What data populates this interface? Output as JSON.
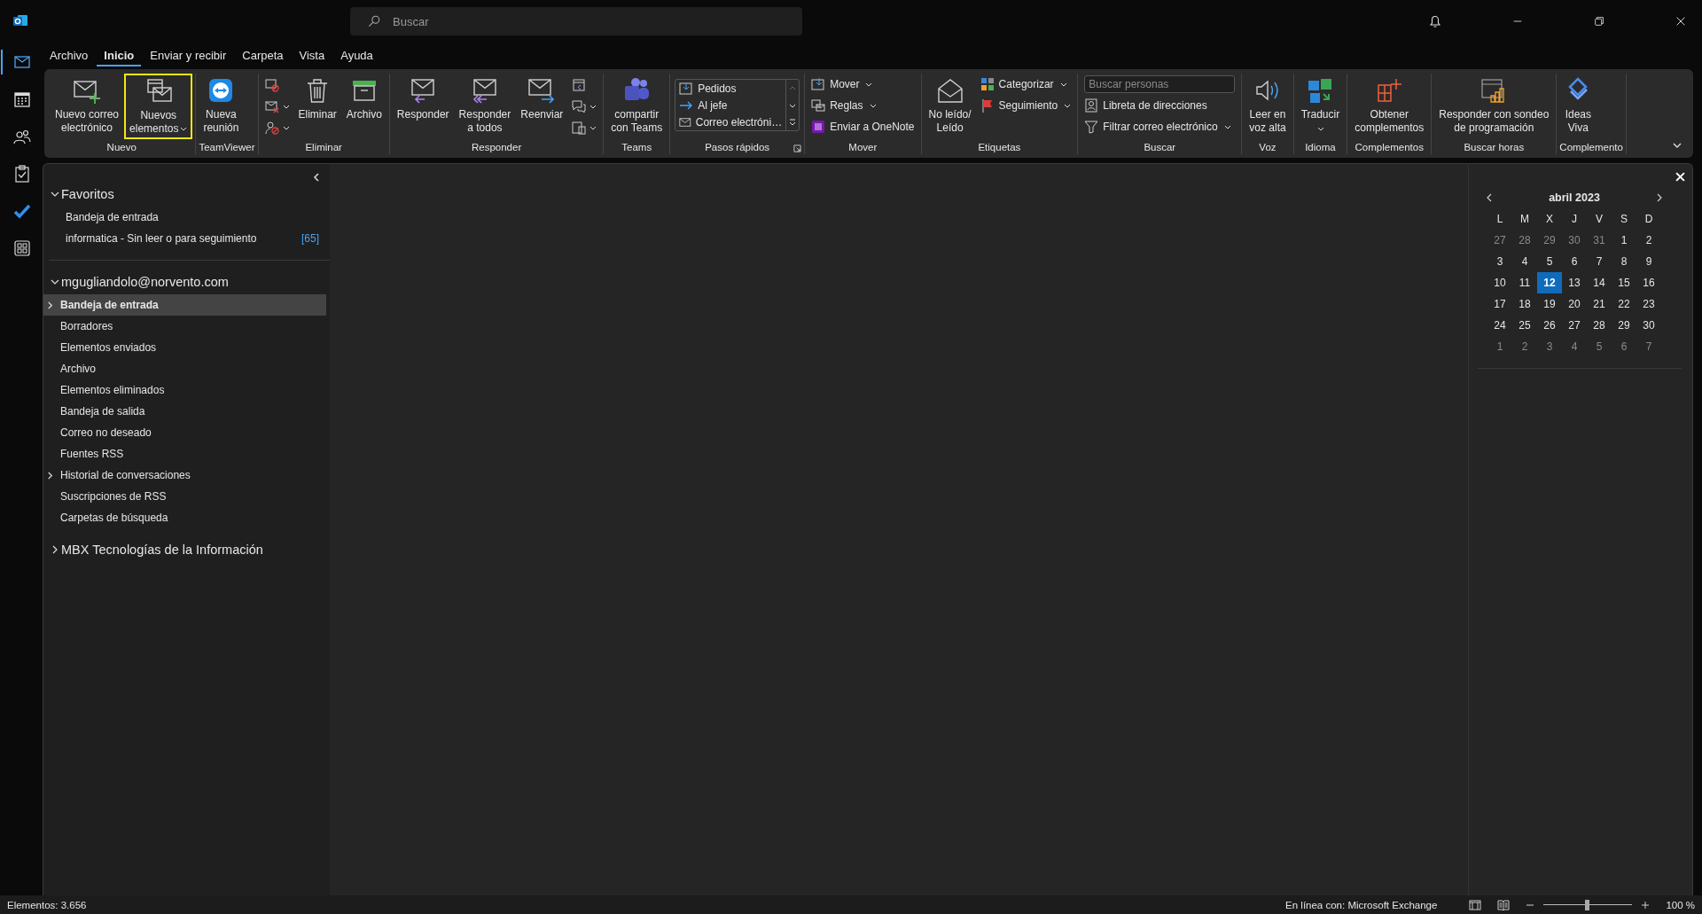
{
  "title_bar": {
    "search_placeholder": "Buscar"
  },
  "nav_rail": [
    {
      "selected": true
    },
    {
      "selected": false
    },
    {
      "selected": false
    },
    {
      "selected": false
    },
    {
      "selected": false
    },
    {
      "selected": false
    }
  ],
  "menu_tabs": [
    {
      "label": "Archivo",
      "selected": false
    },
    {
      "label": "Inicio",
      "selected": true
    },
    {
      "label": "Enviar y recibir",
      "selected": false
    },
    {
      "label": "Carpeta",
      "selected": false
    },
    {
      "label": "Vista",
      "selected": false
    },
    {
      "label": "Ayuda",
      "selected": false
    }
  ],
  "ribbon": {
    "groups": [
      {
        "label": "Nuevo",
        "controls": [
          {
            "kind": "large",
            "label": "Nuevo correo\nelectrónico"
          },
          {
            "kind": "large",
            "label": "Nuevos\nelementos",
            "dropdown": true,
            "highlighted": true
          }
        ]
      },
      {
        "label": "TeamViewer",
        "controls": [
          {
            "kind": "large",
            "label": "Nueva\nreunión"
          }
        ]
      },
      {
        "label": "Eliminar",
        "controls": [
          {
            "kind": "icon_stack",
            "items": [
              {
                "dropdown": false
              },
              {
                "dropdown": true
              },
              {
                "dropdown": true
              }
            ]
          },
          {
            "kind": "large",
            "label": "Eliminar"
          },
          {
            "kind": "large",
            "label": "Archivo"
          }
        ]
      },
      {
        "label": "Responder",
        "controls": [
          {
            "kind": "large",
            "label": "Responder"
          },
          {
            "kind": "large",
            "label": "Responder\na todos"
          },
          {
            "kind": "large",
            "label": "Reenviar"
          },
          {
            "kind": "icon_stack",
            "items": [
              {
                "dropdown": false
              },
              {
                "dropdown": true
              },
              {
                "dropdown": true
              }
            ]
          }
        ]
      },
      {
        "label": "Teams",
        "controls": [
          {
            "kind": "large",
            "label": "compartir\ncon Teams"
          }
        ]
      },
      {
        "label": "Pasos rápidos",
        "launcher": true,
        "controls": [
          {
            "kind": "gallery",
            "items": [
              {
                "label": "Pedidos"
              },
              {
                "label": "Al jefe"
              },
              {
                "label": "Correo electróni…"
              }
            ]
          }
        ]
      },
      {
        "label": "Mover",
        "controls": [
          {
            "kind": "small_stack",
            "items": [
              {
                "label": "Mover",
                "dropdown": true
              },
              {
                "label": "Reglas",
                "dropdown": true
              },
              {
                "label": "Enviar a OneNote",
                "dropdown": false
              }
            ]
          }
        ]
      },
      {
        "label": "Etiquetas",
        "controls": [
          {
            "kind": "large",
            "label": "No leído/\nLeído"
          },
          {
            "kind": "small_stack",
            "items": [
              {
                "label": "Categorizar",
                "dropdown": true
              },
              {
                "label": "Seguimiento",
                "dropdown": true
              }
            ]
          }
        ]
      },
      {
        "label": "Buscar",
        "controls": [
          {
            "kind": "search_stack",
            "placeholder": "Buscar personas",
            "items": [
              {
                "label": "Libreta de direcciones",
                "dropdown": false
              },
              {
                "label": "Filtrar correo electrónico",
                "dropdown": true
              }
            ]
          }
        ]
      },
      {
        "label": "Voz",
        "controls": [
          {
            "kind": "large",
            "label": "Leer en\nvoz alta"
          }
        ]
      },
      {
        "label": "Idioma",
        "controls": [
          {
            "kind": "large_split",
            "label": "Traducir",
            "dropdown": true
          }
        ]
      },
      {
        "label": "Complementos",
        "controls": [
          {
            "kind": "large",
            "label": "Obtener\ncomplementos"
          }
        ]
      },
      {
        "label": "Buscar horas",
        "controls": [
          {
            "kind": "large",
            "label": "Responder con sondeo\nde programación"
          }
        ]
      },
      {
        "label": "Complemento",
        "controls": [
          {
            "kind": "large",
            "label": "Ideas\nViva"
          }
        ]
      }
    ]
  },
  "folder_pane": {
    "sections": [
      {
        "title": "Favoritos",
        "expanded": true,
        "items": [
          {
            "label": "Bandeja de entrada",
            "selected": false
          },
          {
            "label": "informatica - Sin leer o para seguimiento",
            "count": "[65]",
            "selected": false
          }
        ]
      },
      {
        "title": "mgugliandolo@norvento.com",
        "expanded": true,
        "items": [
          {
            "label": "Bandeja de entrada",
            "selected": true,
            "expanded": false
          },
          {
            "label": "Borradores",
            "selected": false
          },
          {
            "label": "Elementos enviados",
            "selected": false
          },
          {
            "label": "Archivo",
            "selected": false
          },
          {
            "label": "Elementos eliminados",
            "selected": false
          },
          {
            "label": "Bandeja de salida",
            "selected": false
          },
          {
            "label": "Correo no deseado",
            "selected": false
          },
          {
            "label": "Fuentes RSS",
            "selected": false
          },
          {
            "label": "Historial de conversaciones",
            "selected": false,
            "expanded": false
          },
          {
            "label": "Suscripciones de RSS",
            "selected": false
          },
          {
            "label": "Carpetas de búsqueda",
            "selected": false
          }
        ]
      },
      {
        "title": "MBX Tecnologías de la Información",
        "expanded": false
      }
    ]
  },
  "calendar": {
    "month": "abril 2023",
    "weekdays": [
      "L",
      "M",
      "X",
      "J",
      "V",
      "S",
      "D"
    ],
    "weeks": [
      [
        {
          "day": "27",
          "other_month": true,
          "selected": false
        },
        {
          "day": "28",
          "other_month": true,
          "selected": false
        },
        {
          "day": "29",
          "other_month": true,
          "selected": false
        },
        {
          "day": "30",
          "other_month": true,
          "selected": false
        },
        {
          "day": "31",
          "other_month": true,
          "selected": false
        },
        {
          "day": "1",
          "other_month": false,
          "selected": false
        },
        {
          "day": "2",
          "other_month": false,
          "selected": false
        }
      ],
      [
        {
          "day": "3",
          "other_month": false,
          "selected": false
        },
        {
          "day": "4",
          "other_month": false,
          "selected": false
        },
        {
          "day": "5",
          "other_month": false,
          "selected": false
        },
        {
          "day": "6",
          "other_month": false,
          "selected": false
        },
        {
          "day": "7",
          "other_month": false,
          "selected": false
        },
        {
          "day": "8",
          "other_month": false,
          "selected": false
        },
        {
          "day": "9",
          "other_month": false,
          "selected": false
        }
      ],
      [
        {
          "day": "10",
          "other_month": false,
          "selected": false
        },
        {
          "day": "11",
          "other_month": false,
          "selected": false
        },
        {
          "day": "12",
          "other_month": false,
          "selected": true
        },
        {
          "day": "13",
          "other_month": false,
          "selected": false
        },
        {
          "day": "14",
          "other_month": false,
          "selected": false
        },
        {
          "day": "15",
          "other_month": false,
          "selected": false
        },
        {
          "day": "16",
          "other_month": false,
          "selected": false
        }
      ],
      [
        {
          "day": "17",
          "other_month": false,
          "selected": false
        },
        {
          "day": "18",
          "other_month": false,
          "selected": false
        },
        {
          "day": "19",
          "other_month": false,
          "selected": false
        },
        {
          "day": "20",
          "other_month": false,
          "selected": false
        },
        {
          "day": "21",
          "other_month": false,
          "selected": false
        },
        {
          "day": "22",
          "other_month": false,
          "selected": false
        },
        {
          "day": "23",
          "other_month": false,
          "selected": false
        }
      ],
      [
        {
          "day": "24",
          "other_month": false,
          "selected": false
        },
        {
          "day": "25",
          "other_month": false,
          "selected": false
        },
        {
          "day": "26",
          "other_month": false,
          "selected": false
        },
        {
          "day": "27",
          "other_month": false,
          "selected": false
        },
        {
          "day": "28",
          "other_month": false,
          "selected": false
        },
        {
          "day": "29",
          "other_month": false,
          "selected": false
        },
        {
          "day": "30",
          "other_month": false,
          "selected": false
        }
      ],
      [
        {
          "day": "1",
          "other_month": true,
          "selected": false
        },
        {
          "day": "2",
          "other_month": true,
          "selected": false
        },
        {
          "day": "3",
          "other_month": true,
          "selected": false
        },
        {
          "day": "4",
          "other_month": true,
          "selected": false
        },
        {
          "day": "5",
          "other_month": true,
          "selected": false
        },
        {
          "day": "6",
          "other_month": true,
          "selected": false
        },
        {
          "day": "7",
          "other_month": true,
          "selected": false
        }
      ]
    ]
  },
  "status_bar": {
    "items_count": "Elementos: 3.656",
    "connection": "En línea con: Microsoft Exchange",
    "zoom": {
      "level": 0.5,
      "reading": "100 %"
    }
  }
}
